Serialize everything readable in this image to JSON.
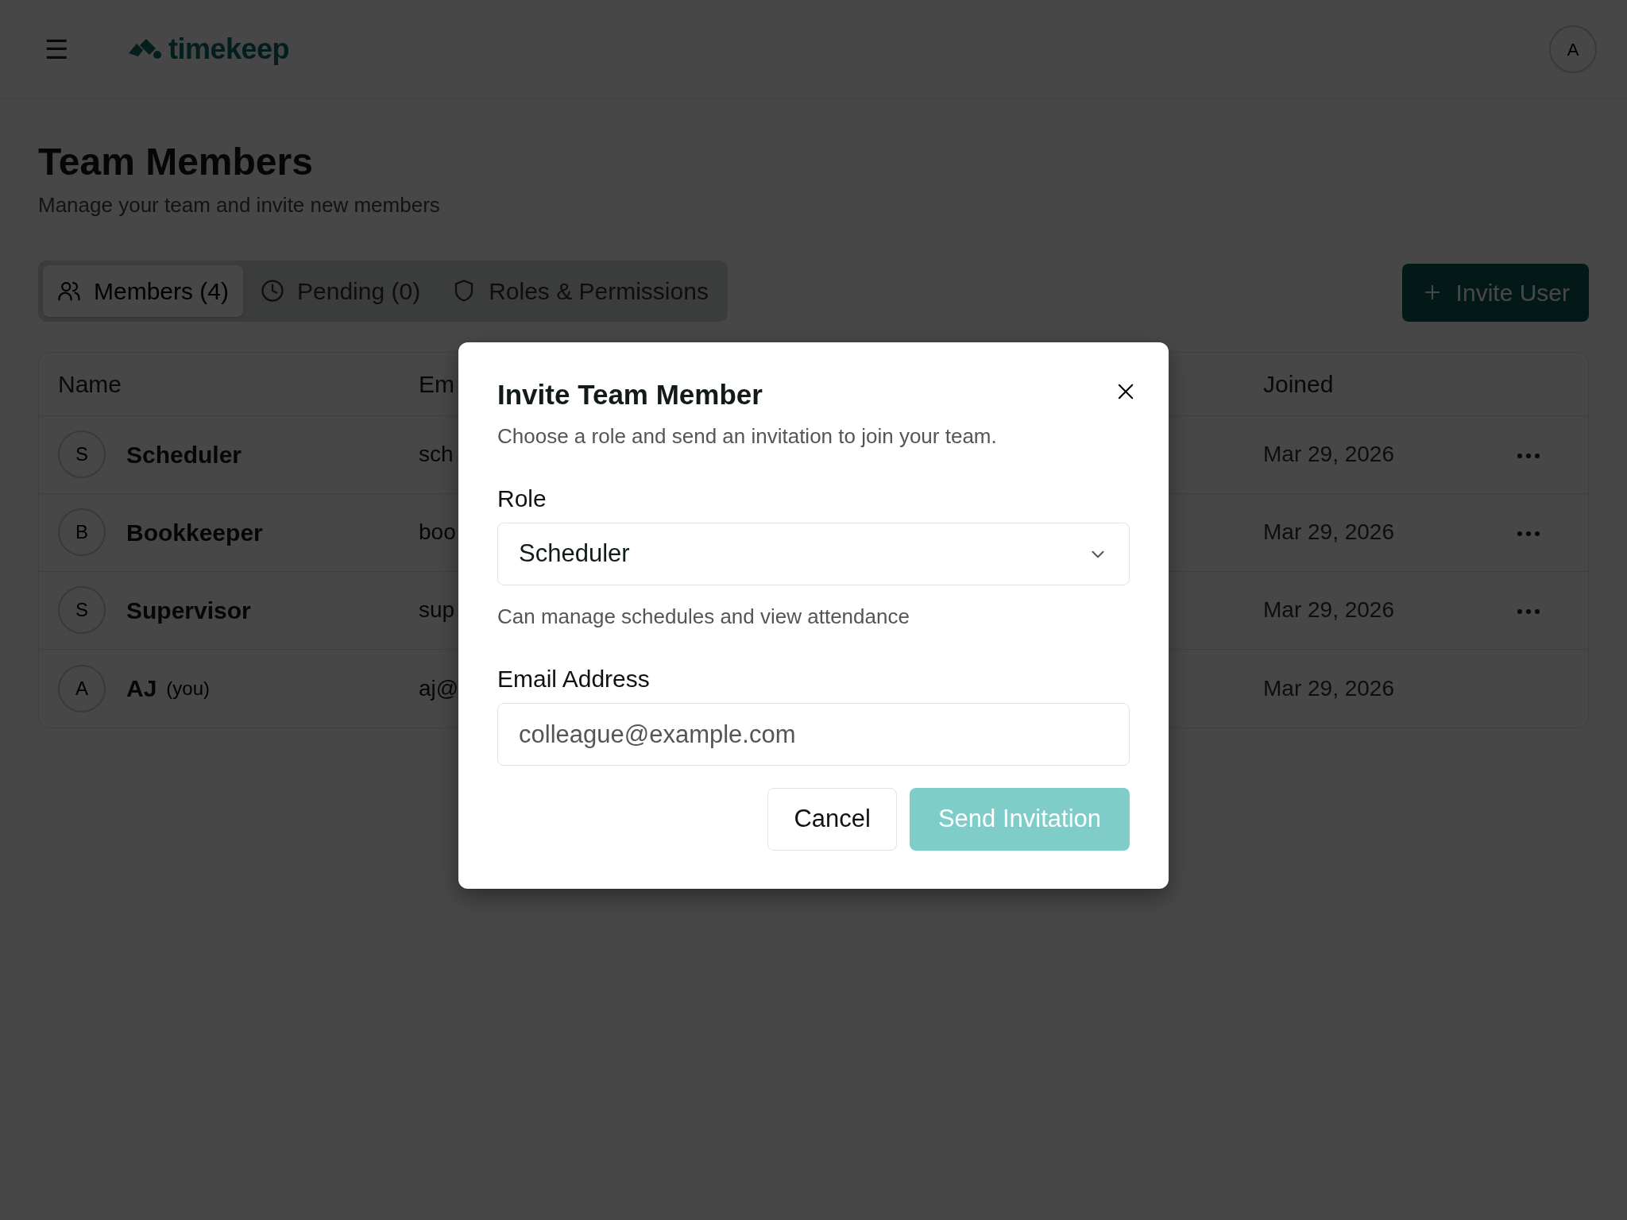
{
  "header": {
    "menu_glyph": "☰",
    "logo_text": "timekeep",
    "avatar": "A"
  },
  "page": {
    "title": "Team Members",
    "subtitle": "Manage your team and invite new members"
  },
  "tabs": [
    {
      "label": "Members (4)",
      "selected": true
    },
    {
      "label": "Pending (0)",
      "selected": false
    },
    {
      "label": "Roles & Permissions",
      "selected": false
    }
  ],
  "invite_button": {
    "label": "Invite User"
  },
  "table": {
    "columns": [
      "Name",
      "Em",
      "Joined"
    ],
    "rows": [
      {
        "initial": "S",
        "name": "Scheduler",
        "email": "sch",
        "joined": "Mar 29, 2026",
        "has_menu": true
      },
      {
        "initial": "B",
        "name": "Bookkeeper",
        "email": "boo",
        "joined": "Mar 29, 2026",
        "has_menu": true
      },
      {
        "initial": "S",
        "name": "Supervisor",
        "email": "sup",
        "joined": "Mar 29, 2026",
        "has_menu": true
      },
      {
        "initial": "A",
        "name": "AJ",
        "tag": "(you)",
        "email": "aj@",
        "joined": "Mar 29, 2026",
        "has_menu": false
      }
    ]
  },
  "dialog": {
    "title": "Invite Team Member",
    "description": "Choose a role and send an invitation to join your team.",
    "role_label": "Role",
    "role_value": "Scheduler",
    "role_help": "Can manage schedules and view attendance",
    "email_label": "Email Address",
    "email_placeholder": "colleague@example.com",
    "cancel": "Cancel",
    "submit": {
      "label": "Send Invitation",
      "disabled": true
    }
  }
}
